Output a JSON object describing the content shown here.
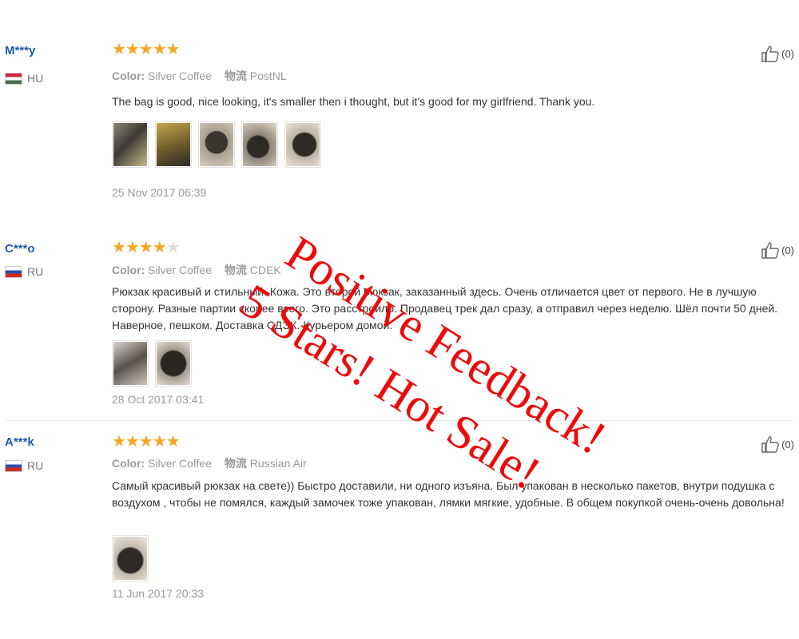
{
  "reviews": [
    {
      "user": "M***y",
      "country": "HU",
      "flag": "hungary-flag",
      "rating": 5,
      "color_label": "Color:",
      "color_value": "Silver Coffee",
      "logistics_label": "物流",
      "logistics_value": "PostNL",
      "text": "The bag is good, nice looking, it's smaller then i thought, but it's good for my girlfriend. Thank you.",
      "photos": 5,
      "date": "25 Nov 2017 06:39",
      "likes": "(0)"
    },
    {
      "user": "C***o",
      "country": "RU",
      "flag": "russia-flag",
      "rating": 4,
      "color_label": "Color:",
      "color_value": "Silver Coffee",
      "logistics_label": "物流",
      "logistics_value": "CDEK",
      "text": "Рюкзак красивый и стильный. Кожа. Это второй рюкзак, заказанный здесь. Очень отличается цвет от первого. Не в лучшую сторону. Разные партии скорее всего. Это расстроило. Продавец трек дал сразу, а отправил через неделю. Шёл почти 50 дней. Наверное, пешком. Доставка СДЭК. Курьером домой.",
      "photos": 2,
      "date": "28 Oct 2017 03:41",
      "likes": "(0)"
    },
    {
      "user": "A***k",
      "country": "RU",
      "flag": "russia-flag",
      "rating": 5,
      "color_label": "Color:",
      "color_value": "Silver Coffee",
      "logistics_label": "物流",
      "logistics_value": "Russian Air",
      "text": "Самый красивый рюкзак на свете)) Быстро доставили, ни одного изъяна. Был упакован в несколько пакетов, внутри подушка с воздухом , чтобы не помялся, каждый замочек тоже упакован, лямки мягкие, удобные. В общем покупкой очень-очень довольна!",
      "photos": 1,
      "date": "11 Jun 2017 20:33",
      "likes": "(0)"
    }
  ],
  "overlay": {
    "line1": "Positive Feedback!",
    "line2": "5 Stars! Hot Sale!",
    "color": "#ee0a0a"
  },
  "colors": {
    "username": "#1a5aa8",
    "star": "#f6a623",
    "muted": "#999999"
  },
  "icons": [
    "thumbs-up-icon",
    "star-icon",
    "hungary-flag",
    "russia-flag"
  ]
}
